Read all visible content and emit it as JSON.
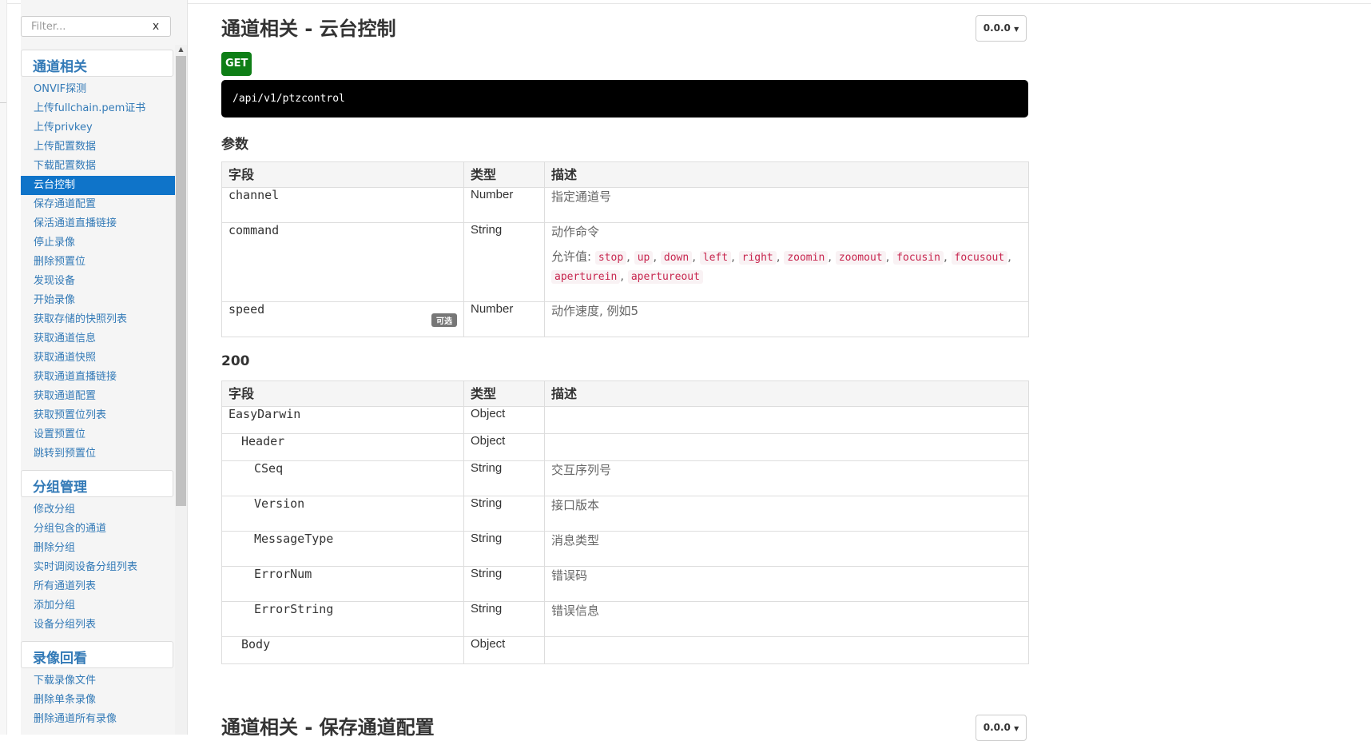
{
  "sidebar": {
    "filter_placeholder": "Filter...",
    "filter_clear": "x",
    "groups": [
      {
        "title": "通道相关",
        "items": [
          "ONVIF探测",
          "上传fullchain.pem证书",
          "上传privkey",
          "上传配置数据",
          "下载配置数据",
          "云台控制",
          "保存通道配置",
          "保活通道直播链接",
          "停止录像",
          "删除预置位",
          "发现设备",
          "开始录像",
          "获取存储的快照列表",
          "获取通道信息",
          "获取通道快照",
          "获取通道直播链接",
          "获取通道配置",
          "获取预置位列表",
          "设置预置位",
          "跳转到预置位"
        ]
      },
      {
        "title": "分组管理",
        "items": [
          "修改分组",
          "分组包含的通道",
          "删除分组",
          "实时调阅设备分组列表",
          "所有通道列表",
          "添加分组",
          "设备分组列表"
        ]
      },
      {
        "title": "录像回看",
        "items": [
          "下载录像文件",
          "删除单条录像",
          "删除通道所有录像"
        ]
      }
    ],
    "active_item": "云台控制"
  },
  "main": {
    "title": "通道相关 - 云台控制",
    "version": "0.0.0",
    "method": "GET",
    "url": "/api/v1/ptzcontrol",
    "params_heading": "参数",
    "columns": {
      "field": "字段",
      "type": "类型",
      "desc": "描述"
    },
    "params": {
      "channel": {
        "field": "channel",
        "type": "Number",
        "desc": "指定通道号"
      },
      "command": {
        "field": "command",
        "type": "String",
        "desc": "动作命令",
        "allowed_label": "允许值:",
        "allowed": [
          "stop",
          "up",
          "down",
          "left",
          "right",
          "zoomin",
          "zoomout",
          "focusin",
          "focusout",
          "aperturein",
          "apertureout"
        ]
      },
      "speed": {
        "field": "speed",
        "badge": "可选",
        "type": "Number",
        "desc": "动作速度, 例如5"
      }
    },
    "response_heading": "200",
    "response": {
      "easydarwin": {
        "field": "EasyDarwin",
        "type": "Object",
        "desc": ""
      },
      "header": {
        "field": "Header",
        "type": "Object",
        "desc": ""
      },
      "cseq": {
        "field": "CSeq",
        "type": "String",
        "desc": "交互序列号"
      },
      "version": {
        "field": "Version",
        "type": "String",
        "desc": "接口版本"
      },
      "messagetype": {
        "field": "MessageType",
        "type": "String",
        "desc": "消息类型"
      },
      "errornum": {
        "field": "ErrorNum",
        "type": "String",
        "desc": "错误码"
      },
      "errorstring": {
        "field": "ErrorString",
        "type": "String",
        "desc": "错误信息"
      },
      "body": {
        "field": "Body",
        "type": "Object",
        "desc": ""
      }
    },
    "next_title": "通道相关 - 保存通道配置",
    "next_version": "0.0.0"
  }
}
